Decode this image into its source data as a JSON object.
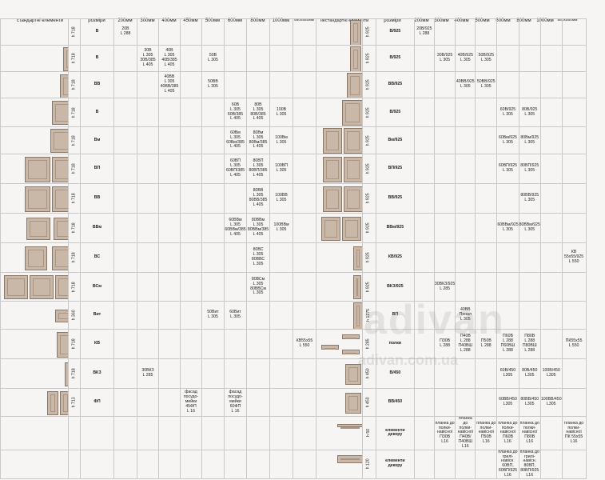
{
  "header": {
    "left_title": "стандартні елементи",
    "left_sizes": "розміри",
    "left_cols": [
      "200мм",
      "300мм",
      "400мм",
      "450мм",
      "500мм",
      "600мм",
      "800мм",
      "1000мм",
      "550x550мм"
    ],
    "right_title": "нестандартні елементи",
    "right_sizes": "розміри",
    "right_cols": [
      "200мм",
      "300мм",
      "400мм",
      "500мм",
      "600мм",
      "800мм",
      "1000мм",
      "550x550мм"
    ]
  },
  "left_rows": [
    {
      "h": "h 718",
      "code": "В",
      "cells": [
        "20В\nL 288",
        "",
        "",
        "",
        "",
        "",
        "",
        "",
        ""
      ]
    },
    {
      "h": "h 718",
      "code": "В",
      "cells": [
        "",
        "30В\nL 305\n30В/385\nL 405",
        "40В\nL 305\n40В/385\nL 405",
        "",
        "50В\nL 305",
        "",
        "",
        "",
        ""
      ]
    },
    {
      "h": "h 718",
      "code": "ВВ",
      "cells": [
        "",
        "",
        "40ВВ\nL 305\n40ВВ/385\nL 405",
        "",
        "50ВВ\nL 305",
        "",
        "",
        "",
        ""
      ]
    },
    {
      "h": "h 718",
      "code": "В",
      "cells": [
        "",
        "",
        "",
        "",
        "",
        "60В\nL 305\n60В/385\nL 405",
        "80В\nL 305\n80В/385\nL 405",
        "100В\nL 305",
        ""
      ]
    },
    {
      "h": "h 718",
      "code": "Вм",
      "cells": [
        "",
        "",
        "",
        "",
        "",
        "60Вм\nL 305\n60Вм/385\nL 405",
        "80Вм\nL 305\n80Вм/385\nL 405",
        "100Вм\nL 305",
        ""
      ]
    },
    {
      "h": "h 718",
      "code": "ВП",
      "cells": [
        "",
        "",
        "",
        "",
        "",
        "60ВП\nL 305\n60ВП/385\nL 405",
        "80ВП\nL 305\n80ВП/385\nL 405",
        "100ВП\nL 305",
        ""
      ]
    },
    {
      "h": "h 718",
      "code": "ВВ",
      "cells": [
        "",
        "",
        "",
        "",
        "",
        "",
        "80ВВ\nL 305\n80ВВ/385\nL 405",
        "100ВВ\nL 305",
        ""
      ]
    },
    {
      "h": "h 718",
      "code": "ВВм",
      "cells": [
        "",
        "",
        "",
        "",
        "",
        "60ВВм\nL 305\n60ВВм/385\nL 405",
        "80ВВм\nL 305\n80ВВм/385\nL 405",
        "100ВВм\nL 305",
        ""
      ]
    },
    {
      "h": "h 718",
      "code": "ВС",
      "cells": [
        "",
        "",
        "",
        "",
        "",
        "",
        "80ВС\nL 305\n80ВВС\nL 305",
        "",
        ""
      ]
    },
    {
      "h": "h 718",
      "code": "ВСм",
      "cells": [
        "",
        "",
        "",
        "",
        "",
        "",
        "80ВСм\nL 305\n80ВВСм\nL 305",
        "",
        ""
      ]
    },
    {
      "h": "h 360",
      "code": "Вит",
      "cells": [
        "",
        "",
        "",
        "",
        "50Вит\nL 305",
        "60Вит\nL 305",
        "",
        "",
        ""
      ]
    },
    {
      "h": "h 718",
      "code": "КВ",
      "cells": [
        "",
        "",
        "",
        "",
        "",
        "",
        "",
        "",
        "КВ55x55\nL 550"
      ]
    },
    {
      "h": "h 718",
      "code": "ВКЗ",
      "cells": [
        "",
        "30ВКЗ\nL 285",
        "",
        "",
        "",
        "",
        "",
        "",
        ""
      ]
    },
    {
      "h": "h 713",
      "code": "ФП",
      "cells": [
        "",
        "",
        "",
        "фасад\nпосудо-\nмийки\n45ФП\nL 16",
        "",
        "фасад\nпосудо-\nмийки\n60ФП\nL 16",
        "",
        "",
        ""
      ]
    }
  ],
  "right_rows": [
    {
      "h": "h 925",
      "code": "В/925",
      "cells": [
        "20В/925\nL 288",
        "",
        "",
        "",
        "",
        "",
        "",
        ""
      ]
    },
    {
      "h": "h 925",
      "code": "В/925",
      "cells": [
        "",
        "30В/925\nL 305",
        "40В/925\nL 305",
        "50В/925\nL 305",
        "",
        "",
        "",
        ""
      ]
    },
    {
      "h": "h 925",
      "code": "ВВ/925",
      "cells": [
        "",
        "",
        "40ВВ/925\nL 305",
        "50ВВ/925\nL 305",
        "",
        "",
        "",
        ""
      ]
    },
    {
      "h": "h 925",
      "code": "В/925",
      "cells": [
        "",
        "",
        "",
        "",
        "60В/925\nL 305",
        "80В/925\nL 305",
        "",
        ""
      ]
    },
    {
      "h": "h 925",
      "code": "Вм/925",
      "cells": [
        "",
        "",
        "",
        "",
        "60Вм/925\nL 305",
        "80Вм/925\nL 305",
        "",
        ""
      ]
    },
    {
      "h": "h 925",
      "code": "ВП/925",
      "cells": [
        "",
        "",
        "",
        "",
        "60ВП/925\nL 305",
        "80ВП/925\nL 305",
        "",
        ""
      ]
    },
    {
      "h": "h 925",
      "code": "ВВ/925",
      "cells": [
        "",
        "",
        "",
        "",
        "",
        "80ВВ/925\nL 305",
        "",
        ""
      ]
    },
    {
      "h": "h 925",
      "code": "ВВм/925",
      "cells": [
        "",
        "",
        "",
        "",
        "60ВВм/925\nL 305",
        "80ВВм/925\nL 305",
        "",
        ""
      ]
    },
    {
      "h": "h 925",
      "code": "КВ/925",
      "cells": [
        "",
        "",
        "",
        "",
        "",
        "",
        "",
        "КВ\n55x55/925\nL 550"
      ]
    },
    {
      "h": "h 925",
      "code": "ВКЗ/925",
      "cells": [
        "",
        "30ВКЗ/925\nL 285",
        "",
        "",
        "",
        "",
        "",
        ""
      ]
    },
    {
      "h": "h 1275",
      "code": "ВП",
      "cells": [
        "",
        "",
        "40ВВ\nПенал\nL 305",
        "",
        "",
        "",
        "",
        ""
      ]
    },
    {
      "h": "h 285",
      "code": "полки",
      "cells": [
        "",
        "П30В\nL 288",
        "П40В\nL 288\nП40ВШ\nL 288",
        "П50В\nL 288",
        "П60В\nL 288\nП60ВШ\nL 288",
        "П80В\nL 288\nП80ВШ\nL 288",
        "",
        "ПК55x55\nL 550"
      ]
    },
    {
      "h": "h 450",
      "code": "В/450",
      "cells": [
        "",
        "",
        "",
        "",
        "60В/450\nL305",
        "80В/450\nL305",
        "100В/450\nL305",
        ""
      ]
    },
    {
      "h": "h 450",
      "code": "ВВ/450",
      "cells": [
        "",
        "",
        "",
        "",
        "60ВВ/450\nL305",
        "80ВВ/450\nL305",
        "100ВВ/450\nL305",
        ""
      ]
    },
    {
      "h": "h 50",
      "code": "елементи\nдекору",
      "cells": [
        "",
        "планка до\nполки-навісної\nП30В\nL16",
        "планка до\nполки-навісної\nП40В/П40ВШ\nL16",
        "планка до\nполки-навісної\nП50В\nL16",
        "планка до\nполки-навісної\nП60В\nL16",
        "планка до\nполки-навісної\nП80В\nL16",
        "",
        "планка до\nполки-навісної\nПК 55x55\nL16"
      ]
    },
    {
      "h": "h 120",
      "code": "елементи\nдекору",
      "cells": [
        "",
        "",
        "",
        "",
        "планка до\nгрилі-навісн.\n60ВП,\n60ВП/925\nL16",
        "планка до\nгрилі-навісн.\n80ВП,\n80ВП/925\nL16",
        "",
        ""
      ]
    }
  ],
  "watermark": {
    "big": "adivan",
    "small": "adivan.com.ua"
  }
}
